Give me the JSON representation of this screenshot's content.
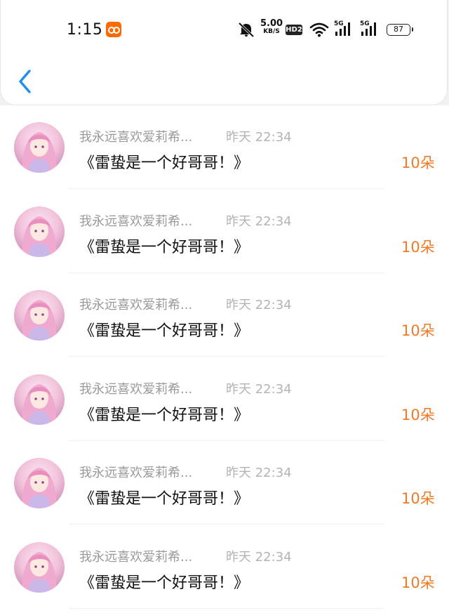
{
  "status_bar": {
    "time": "1:15",
    "net_speed_value": "5.00",
    "net_speed_unit": "KB/S",
    "hd_label": "HD2",
    "signal1_label": "5G",
    "signal2_label": "5G",
    "battery": "87",
    "icons": [
      "app-badge-icon",
      "mute-icon",
      "wifi-icon",
      "signal-icon",
      "signal-icon",
      "battery-icon"
    ]
  },
  "header": {
    "back_icon": "chevron-left-icon"
  },
  "colors": {
    "accent_blue": "#1e8ff0",
    "amount_orange": "#f07a26"
  },
  "rows": [
    {
      "name": "我永远喜欢爱莉希...",
      "time": "昨天 22:34",
      "message": "《雷蛰是一个好哥哥！》",
      "amount": "10朵"
    },
    {
      "name": "我永远喜欢爱莉希...",
      "time": "昨天 22:34",
      "message": "《雷蛰是一个好哥哥！》",
      "amount": "10朵"
    },
    {
      "name": "我永远喜欢爱莉希...",
      "time": "昨天 22:34",
      "message": "《雷蛰是一个好哥哥！》",
      "amount": "10朵"
    },
    {
      "name": "我永远喜欢爱莉希...",
      "time": "昨天 22:34",
      "message": "《雷蛰是一个好哥哥！》",
      "amount": "10朵"
    },
    {
      "name": "我永远喜欢爱莉希...",
      "time": "昨天 22:34",
      "message": "《雷蛰是一个好哥哥！》",
      "amount": "10朵"
    },
    {
      "name": "我永远喜欢爱莉希...",
      "time": "昨天 22:34",
      "message": "《雷蛰是一个好哥哥！》",
      "amount": "10朵"
    }
  ]
}
